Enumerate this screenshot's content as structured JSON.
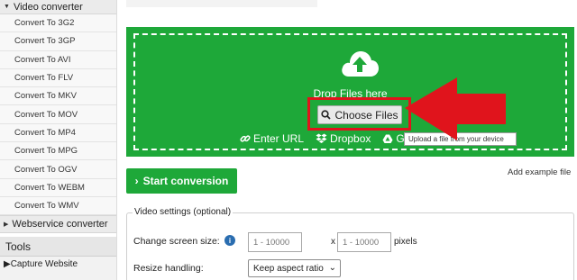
{
  "sidebar": {
    "video_converter": "Video converter",
    "items": [
      {
        "label": "Convert To 3G2"
      },
      {
        "label": "Convert To 3GP"
      },
      {
        "label": "Convert To AVI"
      },
      {
        "label": "Convert To FLV"
      },
      {
        "label": "Convert To MKV"
      },
      {
        "label": "Convert To MOV"
      },
      {
        "label": "Convert To MP4"
      },
      {
        "label": "Convert To MPG"
      },
      {
        "label": "Convert To OGV"
      },
      {
        "label": "Convert To WEBM"
      },
      {
        "label": "Convert To WMV"
      }
    ],
    "webservice_converter": "Webservice converter",
    "tools_title": "Tools",
    "capture_website": "Capture Website"
  },
  "upload": {
    "drop_text": "Drop Files here",
    "choose_files": "Choose Files",
    "enter_url": "Enter URL",
    "dropbox": "Dropbox",
    "google_drive_partial": "G",
    "tooltip": "Upload a file from your device"
  },
  "actions": {
    "start_conversion": "Start conversion",
    "add_example_file": "Add example file"
  },
  "video_settings": {
    "legend": "Video settings (optional)",
    "change_screen_size": "Change screen size:",
    "width_placeholder": "1 - 10000",
    "height_placeholder": "1 - 10000",
    "x": "x",
    "pixels": "pixels",
    "resize_handling": "Resize handling:",
    "resize_option": "Keep aspect ratio"
  },
  "colors": {
    "accent_green": "#1ea839",
    "highlight_red": "#e0141c"
  }
}
